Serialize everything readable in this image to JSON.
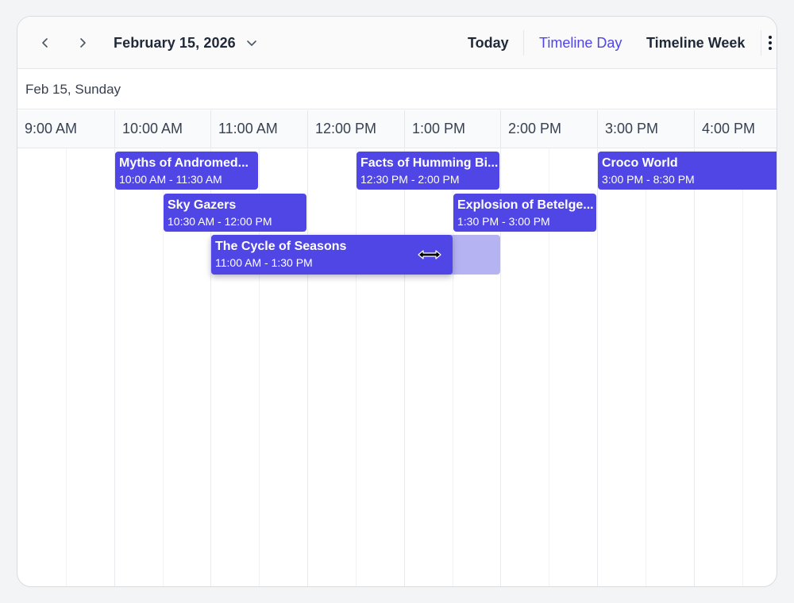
{
  "toolbar": {
    "date_label": "February 15, 2026",
    "today_label": "Today",
    "timeline_day_label": "Timeline Day",
    "timeline_week_label": "Timeline Week",
    "active_view": "Timeline Day",
    "prev_icon": "chevron-left-icon",
    "next_icon": "chevron-right-icon",
    "dropdown_icon": "chevron-down-icon",
    "more_icon": "more-vertical-icon"
  },
  "date_header": {
    "label": "Feb 15, Sunday"
  },
  "time_slots": [
    "9:00 AM",
    "10:00 AM",
    "11:00 AM",
    "12:00 PM",
    "1:00 PM",
    "2:00 PM",
    "3:00 PM",
    "4:00 PM"
  ],
  "events": [
    {
      "title": "Myths of Andromed...",
      "time": "10:00 AM - 11:30 AM"
    },
    {
      "title": "Facts of Humming Bi...",
      "time": "12:30 PM - 2:00 PM"
    },
    {
      "title": "Croco World",
      "time": "3:00 PM - 8:30 PM"
    },
    {
      "title": "Sky Gazers",
      "time": "10:30 AM - 12:00 PM"
    },
    {
      "title": "Explosion of Betelge...",
      "time": "1:30 PM - 3:00 PM"
    },
    {
      "title": "The Cycle of Seasons",
      "time": "11:00 AM - 1:30 PM"
    }
  ],
  "colors": {
    "accent": "#4f46e5",
    "event_bg": "#4f46e5",
    "ghost_bg": "#b6b3f3",
    "text": "#1f2937"
  }
}
